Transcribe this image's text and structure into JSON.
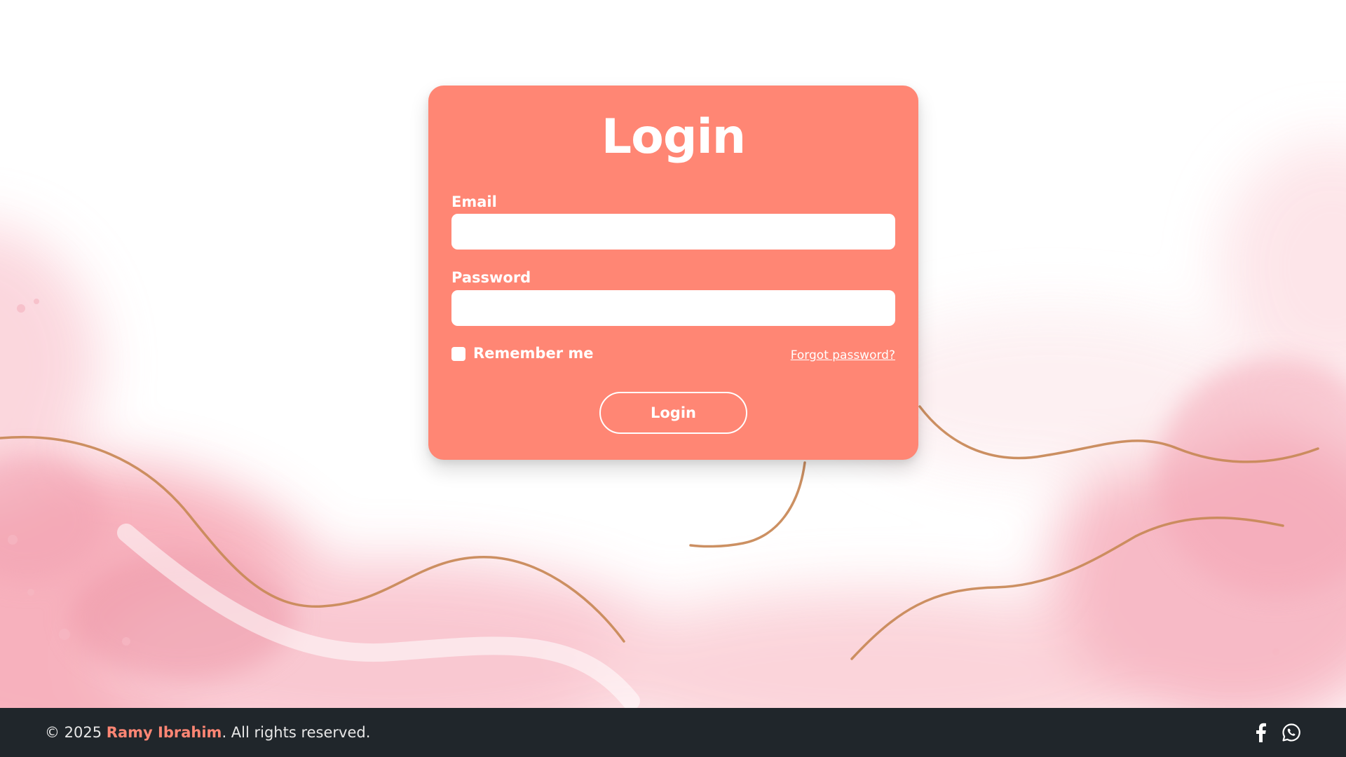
{
  "login": {
    "title": "Login",
    "email_label": "Email",
    "email_value": "",
    "password_label": "Password",
    "password_value": "",
    "remember_label": "Remember me",
    "remember_checked": false,
    "forgot_label": "Forgot password?",
    "submit_label": "Login"
  },
  "footer": {
    "copyright_prefix": "© 2025 ",
    "author": "Ramy Ibrahim",
    "copyright_suffix": ". All rights reserved.",
    "social_icons": [
      "facebook-icon",
      "whatsapp-icon"
    ]
  },
  "colors": {
    "card": "#ff8674",
    "footer": "#20262b",
    "accent": "#ff8674",
    "gold_line": "#c98a5a"
  }
}
